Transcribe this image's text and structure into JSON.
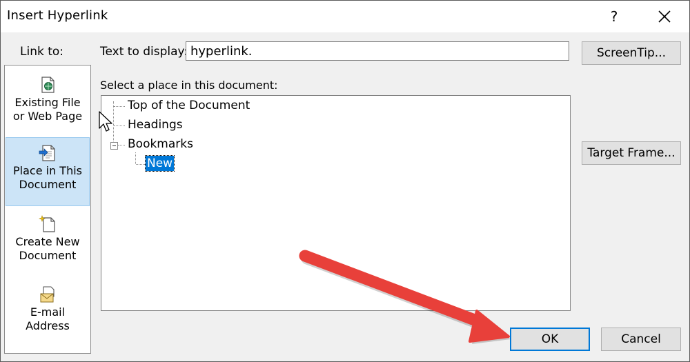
{
  "window": {
    "title": "Insert Hyperlink",
    "help_glyph": "?",
    "close_icon": "close-icon"
  },
  "link_to": {
    "label": "Link to:",
    "items": [
      {
        "label": "Existing File\nor Web Page",
        "icon": "existing-file-web-icon",
        "selected": false
      },
      {
        "label": "Place in This\nDocument",
        "icon": "place-in-document-icon",
        "selected": true
      },
      {
        "label": "Create New\nDocument",
        "icon": "create-new-document-icon",
        "selected": false
      },
      {
        "label": "E-mail\nAddress",
        "icon": "email-address-icon",
        "selected": false
      }
    ]
  },
  "text_to_display": {
    "label": "Text to display:",
    "value": "hyperlink."
  },
  "buttons": {
    "screentip": "ScreenTip...",
    "target_frame": "Target Frame...",
    "ok": "OK",
    "cancel": "Cancel"
  },
  "place": {
    "label": "Select a place in this document:",
    "tree": [
      {
        "label": "Top of the Document"
      },
      {
        "label": "Headings"
      },
      {
        "label": "Bookmarks",
        "expanded": true,
        "children": [
          {
            "label": "New",
            "selected": true
          }
        ]
      }
    ]
  },
  "colors": {
    "selection": "#0078d7",
    "nav_selected": "#cce4f7",
    "annotation_arrow": "#e8403a"
  }
}
